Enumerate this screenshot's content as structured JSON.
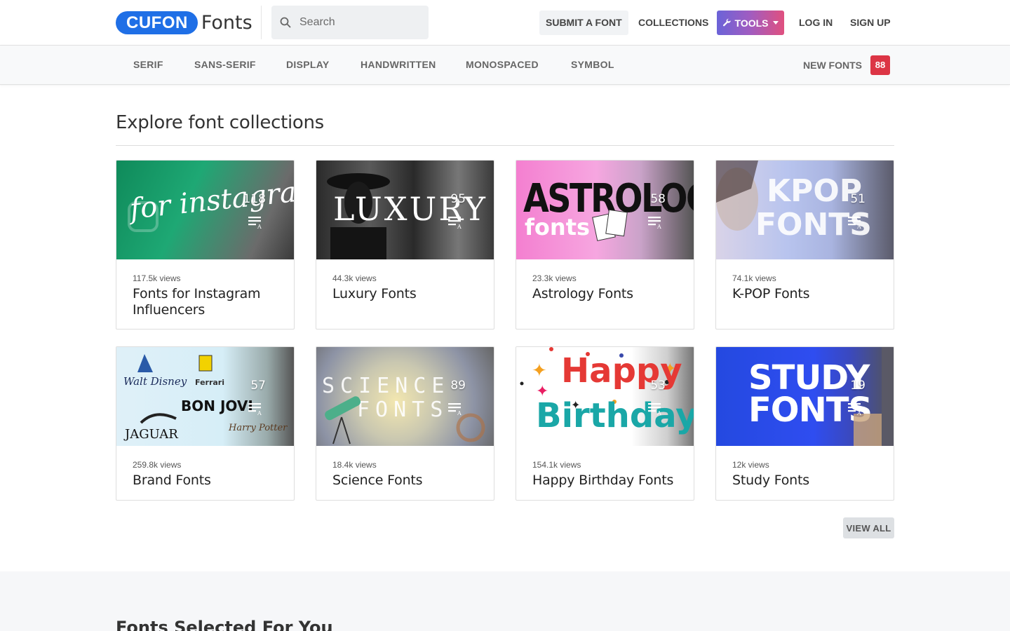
{
  "header": {
    "logo_badge": "CUFON",
    "logo_text": "Fonts",
    "search_placeholder": "Search",
    "nav": {
      "submit": "SUBMIT A FONT",
      "collections": "COLLECTIONS",
      "tools": "TOOLS",
      "login": "LOG IN",
      "signup": "SIGN UP"
    }
  },
  "categories": [
    "SERIF",
    "SANS-SERIF",
    "DISPLAY",
    "HANDWRITTEN",
    "MONOSPACED",
    "SYMBOL"
  ],
  "new_fonts": {
    "label": "NEW FONTS",
    "count": "88"
  },
  "section_title": "Explore font collections",
  "cards": [
    {
      "views": "117.5k views",
      "title": "Fonts for Instagram Influencers",
      "count": "118",
      "img_text": "for instagram influencers"
    },
    {
      "views": "44.3k views",
      "title": "Luxury Fonts",
      "count": "95",
      "img_text": "LUXURY"
    },
    {
      "views": "23.3k views",
      "title": "Astrology Fonts",
      "count": "58",
      "img_text": "ASTROLOGY",
      "img_text2": "fonts"
    },
    {
      "views": "74.1k views",
      "title": "K-POP Fonts",
      "count": "51",
      "img_text": "KPOP",
      "img_text2": "FONTS"
    },
    {
      "views": "259.8k views",
      "title": "Brand Fonts",
      "count": "57",
      "img_text": "BON JOVI",
      "img_text2": "JAGUAR",
      "img_text3": "Ferrari",
      "img_text4": "Walt Disney",
      "img_text5": "Harry Potter"
    },
    {
      "views": "18.4k views",
      "title": "Science Fonts",
      "count": "89",
      "img_text": "SCIENCE",
      "img_text2": "FONTS"
    },
    {
      "views": "154.1k views",
      "title": "Happy Birthday Fonts",
      "count": "53",
      "img_text": "Happy",
      "img_text2": "Birthday!"
    },
    {
      "views": "12k views",
      "title": "Study Fonts",
      "count": "19",
      "img_text": "STUDY",
      "img_text2": "FONTS"
    }
  ],
  "view_all": "VIEW ALL",
  "section2_title": "Fonts Selected For You"
}
